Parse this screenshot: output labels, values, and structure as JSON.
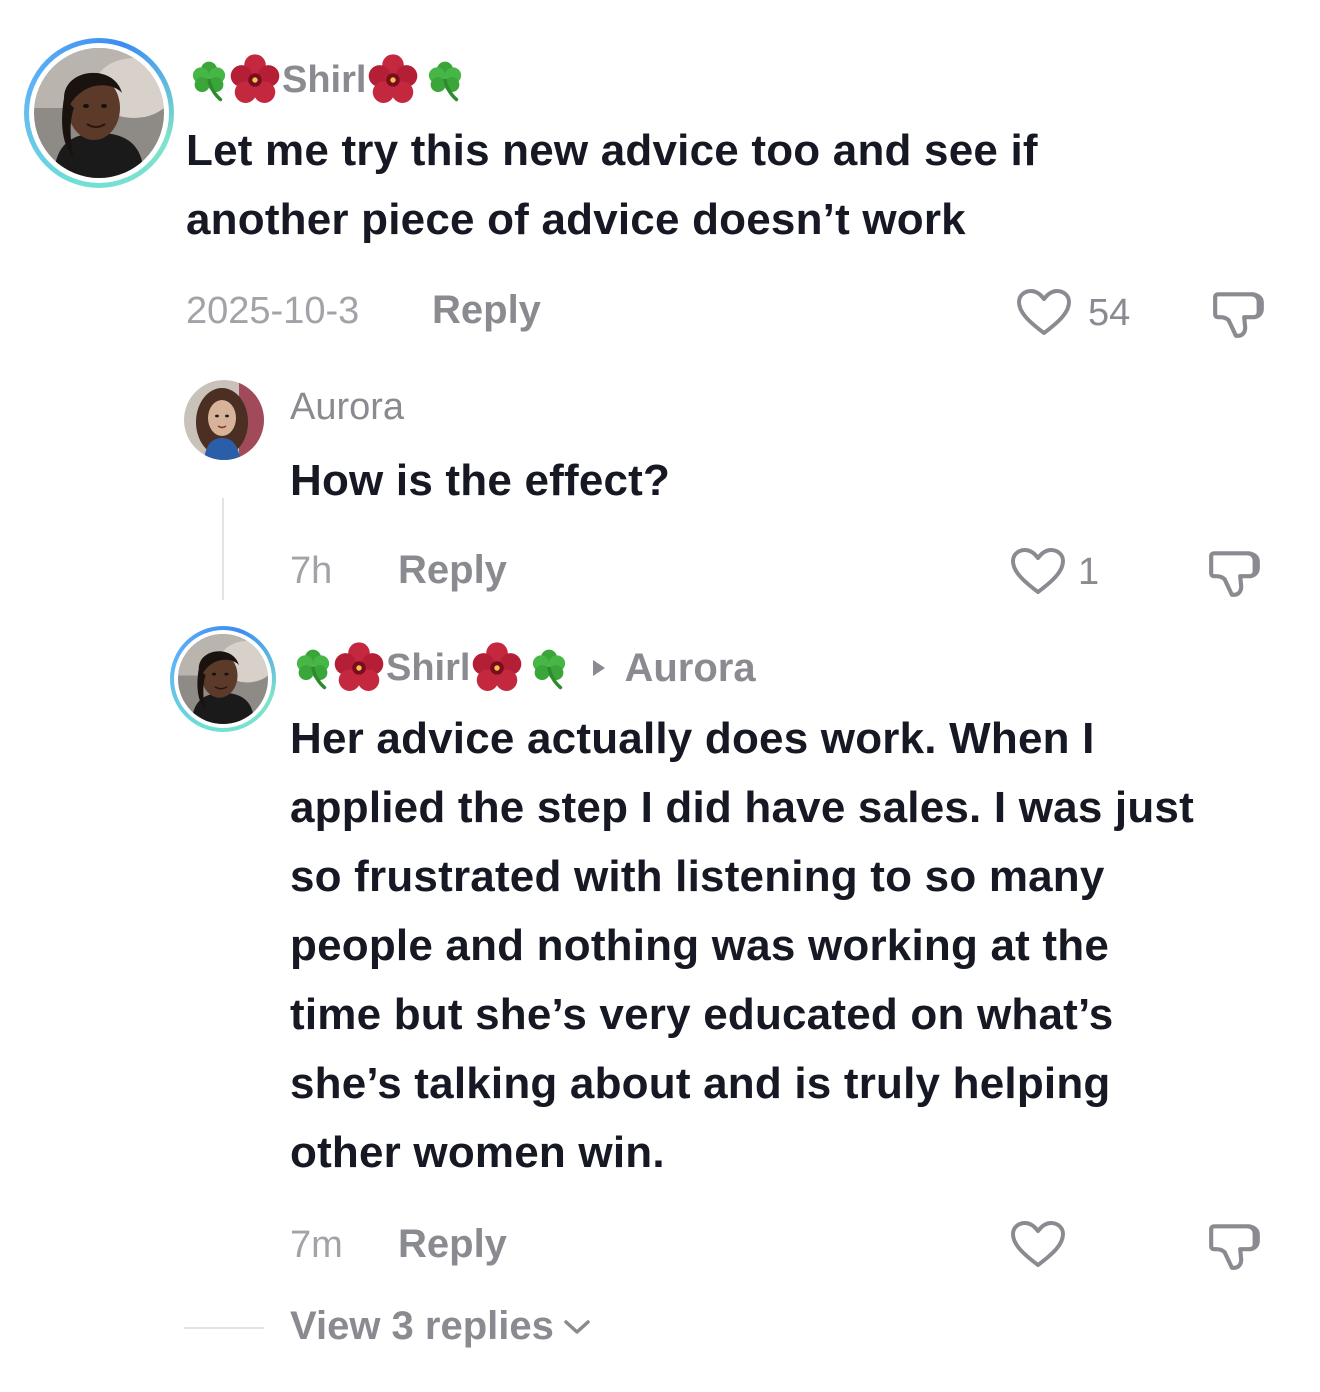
{
  "comments": [
    {
      "username": "Shirl",
      "name_prefix_emoji": [
        "shamrock",
        "hibiscus"
      ],
      "name_suffix_emoji": [
        "hibiscus",
        "shamrock"
      ],
      "text": "Let me try this new advice too and see if another piece of advice doesn’t work",
      "date": "2025-10-3",
      "reply_label": "Reply",
      "likes": "54"
    },
    {
      "username": "Aurora",
      "text": "How is the effect?",
      "date": "7h",
      "reply_label": "Reply",
      "likes": "1"
    },
    {
      "username": "Shirl",
      "name_prefix_emoji": [
        "shamrock",
        "hibiscus"
      ],
      "name_suffix_emoji": [
        "hibiscus",
        "shamrock"
      ],
      "reply_to": "Aurora",
      "text_lines": [
        "Her advice actually does work. When I",
        "applied the step I did have sales. I was just",
        "so frustrated with listening to so many",
        "people and nothing was working at the",
        "time but she’s very educated on what’s",
        "she’s talking about and is truly helping",
        "other women win."
      ],
      "date": "7m",
      "reply_label": "Reply",
      "likes": ""
    }
  ],
  "view_replies_label": "View 3 replies",
  "colors": {
    "text_primary": "#161823",
    "text_secondary": "#8a8b91",
    "ring_gradient": [
      "#6ee0d6",
      "#3b8cf3"
    ],
    "shamrock": "#3aa63a",
    "hibiscus": "#c4283f"
  }
}
